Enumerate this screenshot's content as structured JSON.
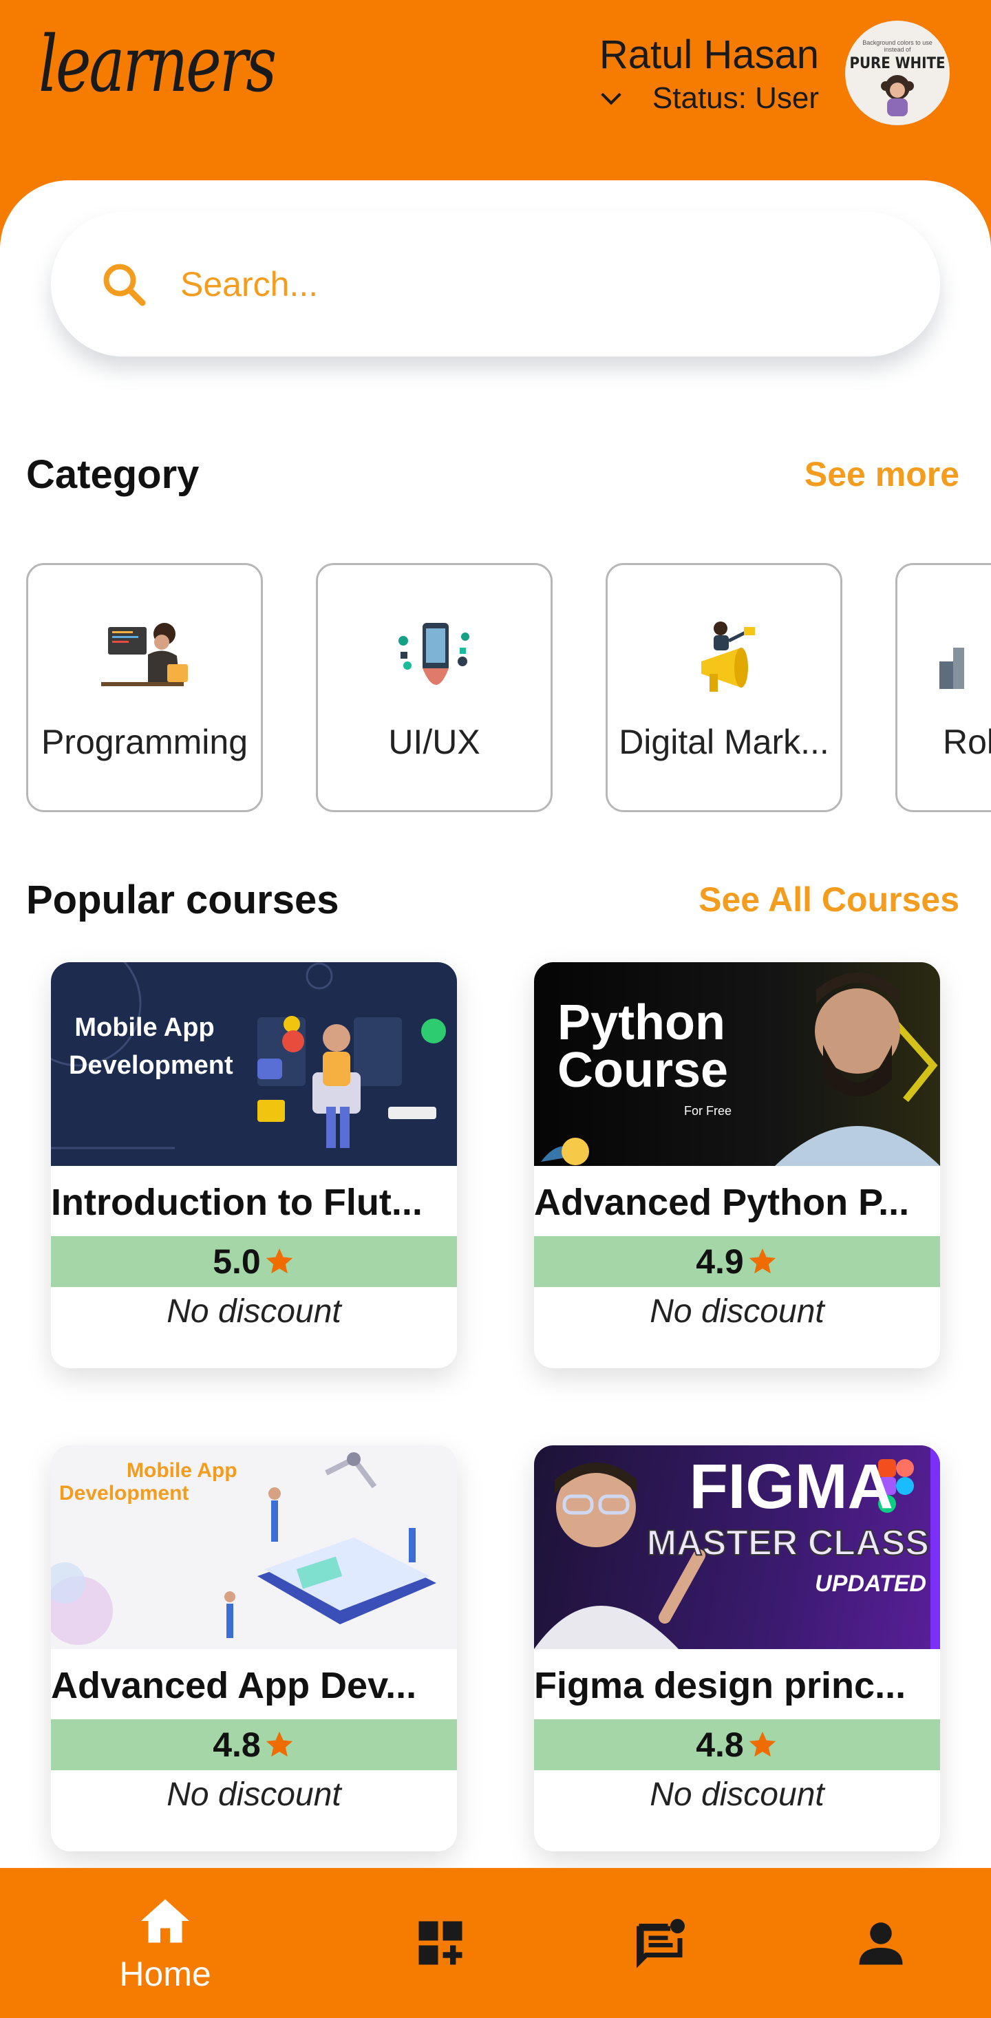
{
  "header": {
    "logo": "learners",
    "user_name": "Ratul Hasan",
    "status": "Status: User",
    "avatar": {
      "top_text": "Background colors to use instead of",
      "title": "PURE WHITE"
    }
  },
  "search": {
    "placeholder": "Search..."
  },
  "category": {
    "title": "Category",
    "see_more": "See more",
    "items": [
      {
        "label": "Programming"
      },
      {
        "label": "UI/UX"
      },
      {
        "label": "Digital Mark..."
      },
      {
        "label": "Rob"
      }
    ]
  },
  "popular": {
    "title": "Popular courses",
    "see_all": "See All Courses",
    "courses": [
      {
        "title": "Introduction to Flut...",
        "rating": "5.0",
        "discount": "No discount",
        "thumb_text": [
          "Mobile App",
          "Development"
        ]
      },
      {
        "title": "Advanced Python P...",
        "rating": "4.9",
        "discount": "No discount",
        "thumb_text": [
          "Python",
          "Course",
          "For Free"
        ]
      },
      {
        "title": "Advanced App Dev...",
        "rating": "4.8",
        "discount": "No discount",
        "thumb_text": [
          "Mobile App",
          "Development"
        ]
      },
      {
        "title": "Figma design princ...",
        "rating": "4.8",
        "discount": "No discount",
        "thumb_text": [
          "FIGMA",
          "MASTER CLASS",
          "UPDATED"
        ]
      }
    ]
  },
  "nav": {
    "items": [
      {
        "label": "Home",
        "icon": "home-icon"
      },
      {
        "label": "",
        "icon": "grid-add-icon"
      },
      {
        "label": "",
        "icon": "chat-notification-icon"
      },
      {
        "label": "",
        "icon": "person-icon"
      }
    ]
  },
  "colors": {
    "primary": "#f57c00",
    "accent": "#f39c1d",
    "rating_bg": "#a5d6a7",
    "star": "#ef6c00"
  }
}
